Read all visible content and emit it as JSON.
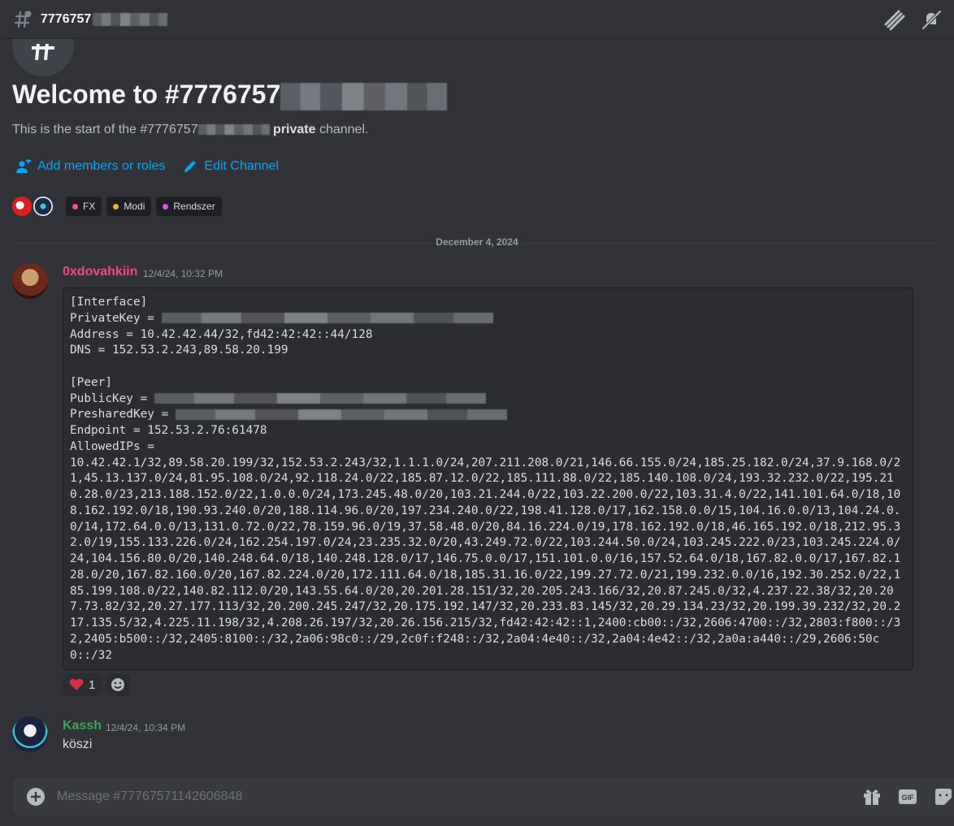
{
  "header": {
    "channel_name": "7776757",
    "icons": [
      "threads-icon",
      "mute-icon"
    ]
  },
  "welcome": {
    "title": "Welcome to #7776757",
    "subtitle_prefix": "This is the start of the #7776757",
    "subtitle_bold": "private",
    "subtitle_suffix": " channel.",
    "add_members": "Add members or roles",
    "edit_channel": "Edit Channel"
  },
  "roles": [
    {
      "name": "FX",
      "color": "#f04fa0"
    },
    {
      "name": "Modi",
      "color": "#f0b232"
    },
    {
      "name": "Rendszer",
      "color": "#e44fef"
    }
  ],
  "date_divider": "December 4, 2024",
  "messages": [
    {
      "author": "0xdovahkiin",
      "author_color": "#f0468c",
      "timestamp": "12/4/24, 10:32 PM",
      "code": "[Interface]\nPrivateKey = ",
      "code_address": "Address = 10.42.42.44/32,fd42:42:42::44/128\nDNS = 152.53.2.243,89.58.20.199\n\n[Peer]\nPublicKey = ",
      "code_preshared": "PresharedKey = ",
      "code_rest": "Endpoint = 152.53.2.76:61478\nAllowedIPs =\n10.42.42.1/32,89.58.20.199/32,152.53.2.243/32,1.1.1.0/24,207.211.208.0/21,146.66.155.0/24,185.25.182.0/24,37.9.168.0/21,45.13.137.0/24,81.95.108.0/24,92.118.24.0/22,185.87.12.0/22,185.111.88.0/22,185.140.108.0/24,193.32.232.0/22,195.210.28.0/23,213.188.152.0/22,1.0.0.0/24,173.245.48.0/20,103.21.244.0/22,103.22.200.0/22,103.31.4.0/22,141.101.64.0/18,108.162.192.0/18,190.93.240.0/20,188.114.96.0/20,197.234.240.0/22,198.41.128.0/17,162.158.0.0/15,104.16.0.0/13,104.24.0.0/14,172.64.0.0/13,131.0.72.0/22,78.159.96.0/19,37.58.48.0/20,84.16.224.0/19,178.162.192.0/18,46.165.192.0/18,212.95.32.0/19,155.133.226.0/24,162.254.197.0/24,23.235.32.0/20,43.249.72.0/22,103.244.50.0/24,103.245.222.0/23,103.245.224.0/24,104.156.80.0/20,140.248.64.0/18,140.248.128.0/17,146.75.0.0/17,151.101.0.0/16,157.52.64.0/18,167.82.0.0/17,167.82.128.0/20,167.82.160.0/20,167.82.224.0/20,172.111.64.0/18,185.31.16.0/22,199.27.72.0/21,199.232.0.0/16,192.30.252.0/22,185.199.108.0/22,140.82.112.0/20,143.55.64.0/20,20.201.28.151/32,20.205.243.166/32,20.87.245.0/32,4.237.22.38/32,20.207.73.82/32,20.27.177.113/32,20.200.245.247/32,20.175.192.147/32,20.233.83.145/32,20.29.134.23/32,20.199.39.232/32,20.217.135.5/32,4.225.11.198/32,4.208.26.197/32,20.26.156.215/32,fd42:42:42::1,2400:cb00::/32,2606:4700::/32,2803:f800::/32,2405:b500::/32,2405:8100::/32,2a06:98c0::/29,2c0f:f248::/32,2a04:4e40::/32,2a04:4e42::/32,2a0a:a440::/29,2606:50c0::/32",
      "reaction_count": "1"
    },
    {
      "author": "Kassh",
      "author_color": "#3ba55c",
      "timestamp": "12/4/24, 10:34 PM",
      "text": "köszi"
    }
  ],
  "composer": {
    "placeholder": "Message #77767571142606848"
  }
}
